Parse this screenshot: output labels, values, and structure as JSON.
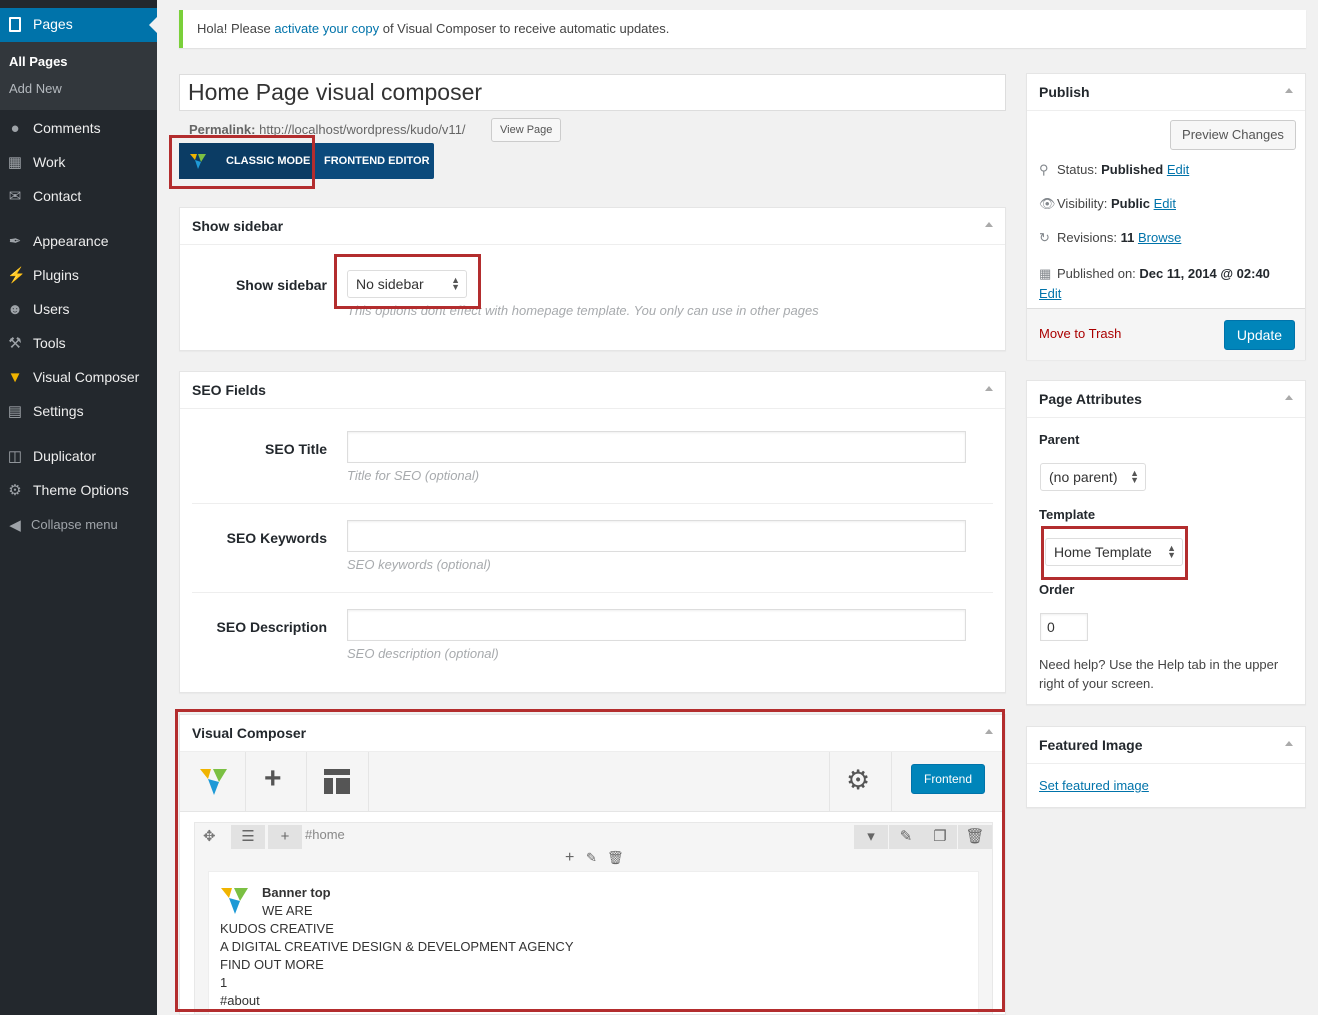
{
  "sidebar": {
    "current": "Pages",
    "submenu": [
      "All Pages",
      "Add New"
    ],
    "items": [
      {
        "label": "Comments",
        "icon": "comments-icon"
      },
      {
        "label": "Work",
        "icon": "calendar-icon"
      },
      {
        "label": "Contact",
        "icon": "mail-icon"
      },
      {
        "label": "Appearance",
        "icon": "paintbrush-icon"
      },
      {
        "label": "Plugins",
        "icon": "plugin-icon"
      },
      {
        "label": "Users",
        "icon": "user-icon"
      },
      {
        "label": "Tools",
        "icon": "wrench-icon"
      },
      {
        "label": "Visual Composer",
        "icon": "vc-logo-icon"
      },
      {
        "label": "Settings",
        "icon": "settings-icon"
      },
      {
        "label": "Duplicator",
        "icon": "database-icon"
      },
      {
        "label": "Theme Options",
        "icon": "gear-icon"
      },
      {
        "label": "Collapse menu",
        "icon": "collapse-icon"
      }
    ]
  },
  "notice": {
    "prefix": "Hola! Please ",
    "link": "activate your copy",
    "suffix": " of Visual Composer to receive automatic updates."
  },
  "editor": {
    "title": "Home Page visual composer",
    "permalink_label": "Permalink:",
    "permalink_url": "http://localhost/wordpress/kudo/v11/",
    "view_page": "View Page",
    "classic_mode": "CLASSIC MODE",
    "frontend_editor": "FRONTEND EDITOR"
  },
  "show_sidebar": {
    "box_title": "Show sidebar",
    "label": "Show sidebar",
    "value": "No sidebar",
    "hint": "This options dont effect with homepage template. You only can use in other pages"
  },
  "seo": {
    "box_title": "SEO Fields",
    "fields": [
      {
        "label": "SEO Title",
        "hint": "Title for SEO (optional)",
        "value": ""
      },
      {
        "label": "SEO Keywords",
        "hint": "SEO keywords (optional)",
        "value": ""
      },
      {
        "label": "SEO Description",
        "hint": "SEO description (optional)",
        "value": ""
      }
    ]
  },
  "vc": {
    "box_title": "Visual Composer",
    "frontend_btn": "Frontend",
    "row_id": "#home",
    "element_title": "Banner top",
    "lines": [
      "WE ARE",
      "KUDOS CREATIVE",
      "A DIGITAL CREATIVE DESIGN & DEVELOPMENT AGENCY",
      "FIND OUT MORE",
      "1",
      "#about"
    ]
  },
  "publish": {
    "title": "Publish",
    "preview": "Preview Changes",
    "status_label": "Status:",
    "status": "Published",
    "visibility_label": "Visibility:",
    "visibility": "Public",
    "revisions_label": "Revisions:",
    "revisions": "11",
    "browse": "Browse",
    "published_label": "Published on:",
    "published": "Dec 11, 2014 @ 02:40",
    "edit": "Edit",
    "trash": "Move to Trash",
    "update": "Update"
  },
  "attributes": {
    "title": "Page Attributes",
    "parent_label": "Parent",
    "parent": "(no parent)",
    "template_label": "Template",
    "template": "Home Template",
    "order_label": "Order",
    "order": "0",
    "help": "Need help? Use the Help tab in the upper right of your screen."
  },
  "featured": {
    "title": "Featured Image",
    "link": "Set featured image"
  }
}
